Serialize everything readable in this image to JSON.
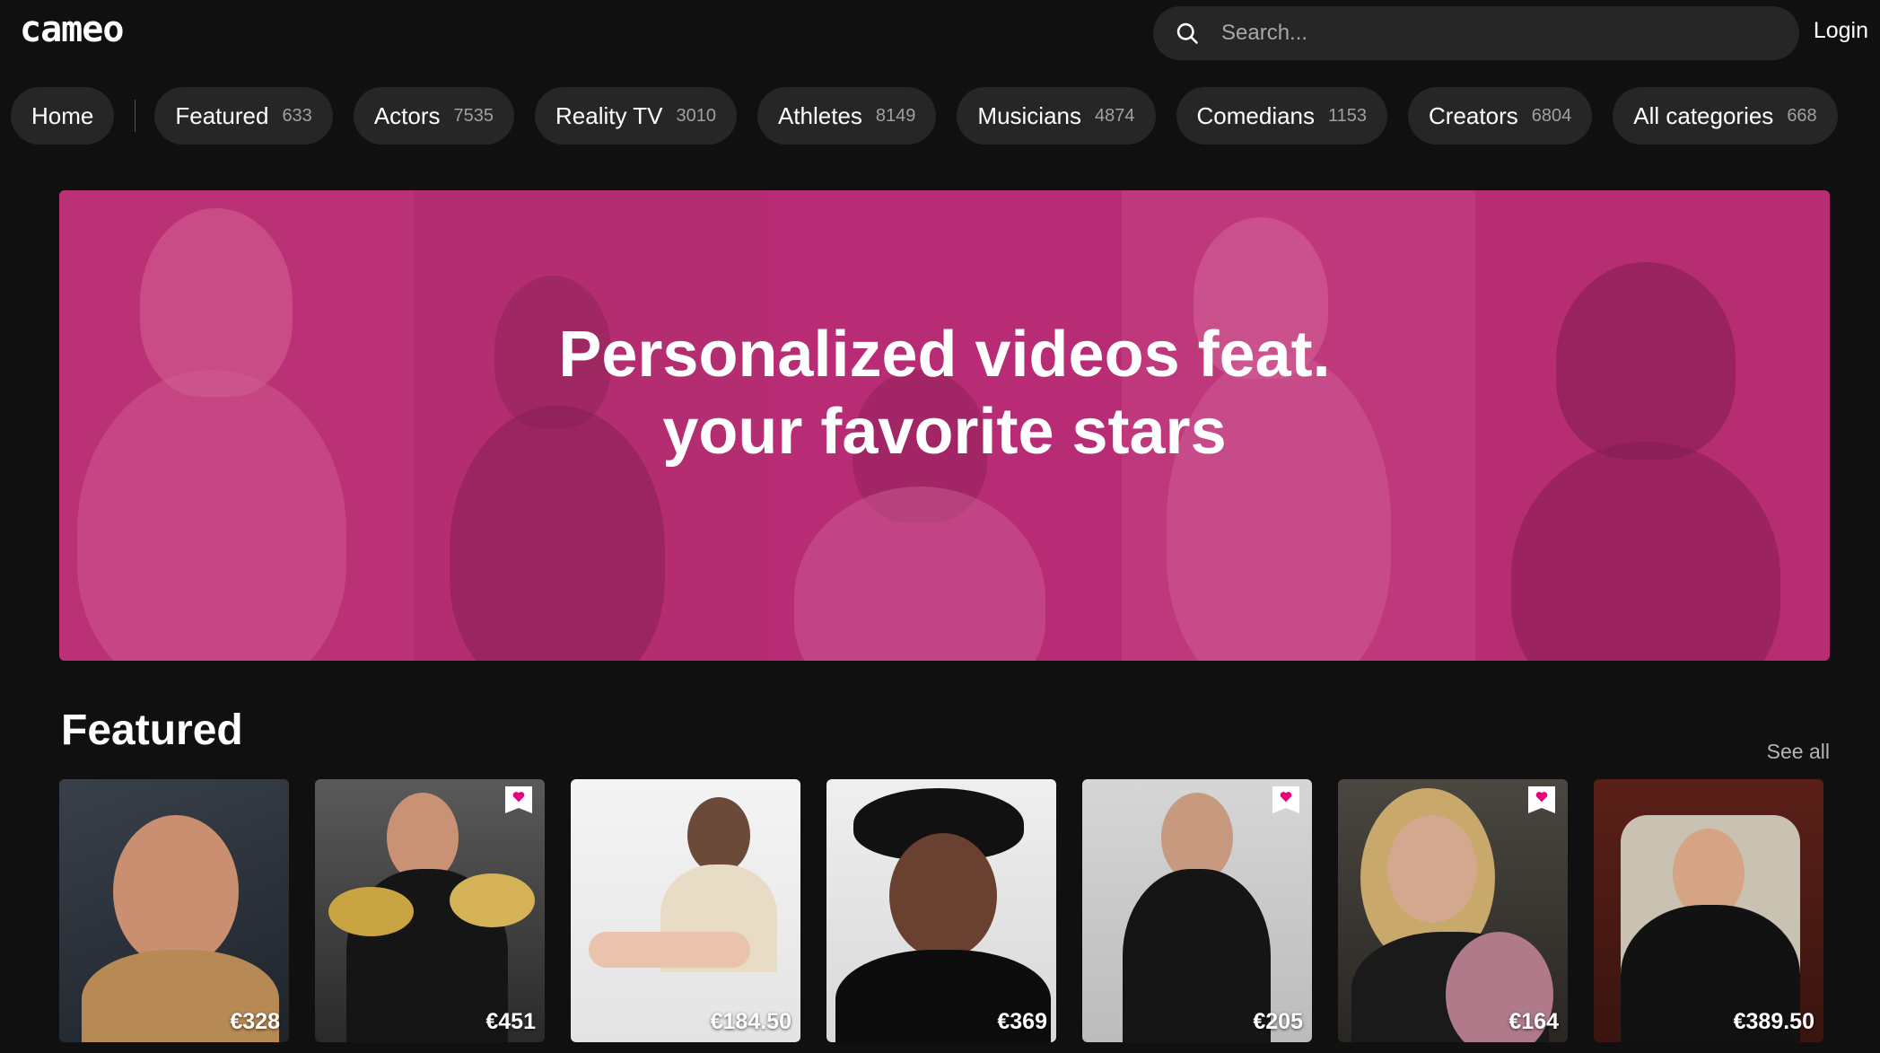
{
  "header": {
    "logo": "cameo",
    "search_placeholder": "Search...",
    "login_label": "Login"
  },
  "nav": {
    "home": "Home",
    "categories": [
      {
        "label": "Featured",
        "count": "633"
      },
      {
        "label": "Actors",
        "count": "7535"
      },
      {
        "label": "Reality TV",
        "count": "3010"
      },
      {
        "label": "Athletes",
        "count": "8149"
      },
      {
        "label": "Musicians",
        "count": "4874"
      },
      {
        "label": "Comedians",
        "count": "1153"
      },
      {
        "label": "Creators",
        "count": "6804"
      },
      {
        "label": "All categories",
        "count": "668"
      }
    ]
  },
  "hero": {
    "title_line1": "Personalized videos feat.",
    "title_line2": "your favorite stars"
  },
  "featured": {
    "title": "Featured",
    "see_all": "See all",
    "cards": [
      {
        "price": "€328",
        "fav": false
      },
      {
        "price": "€451",
        "fav": true
      },
      {
        "price": "€184.50",
        "fav": false
      },
      {
        "price": "€369",
        "fav": false
      },
      {
        "price": "€205",
        "fav": true
      },
      {
        "price": "€164",
        "fav": true
      },
      {
        "price": "€389.50",
        "fav": false
      }
    ]
  },
  "colors": {
    "background": "#101010",
    "pill": "#262626",
    "accent_pink": "#e8007d",
    "hero_tint": "#c42470"
  }
}
